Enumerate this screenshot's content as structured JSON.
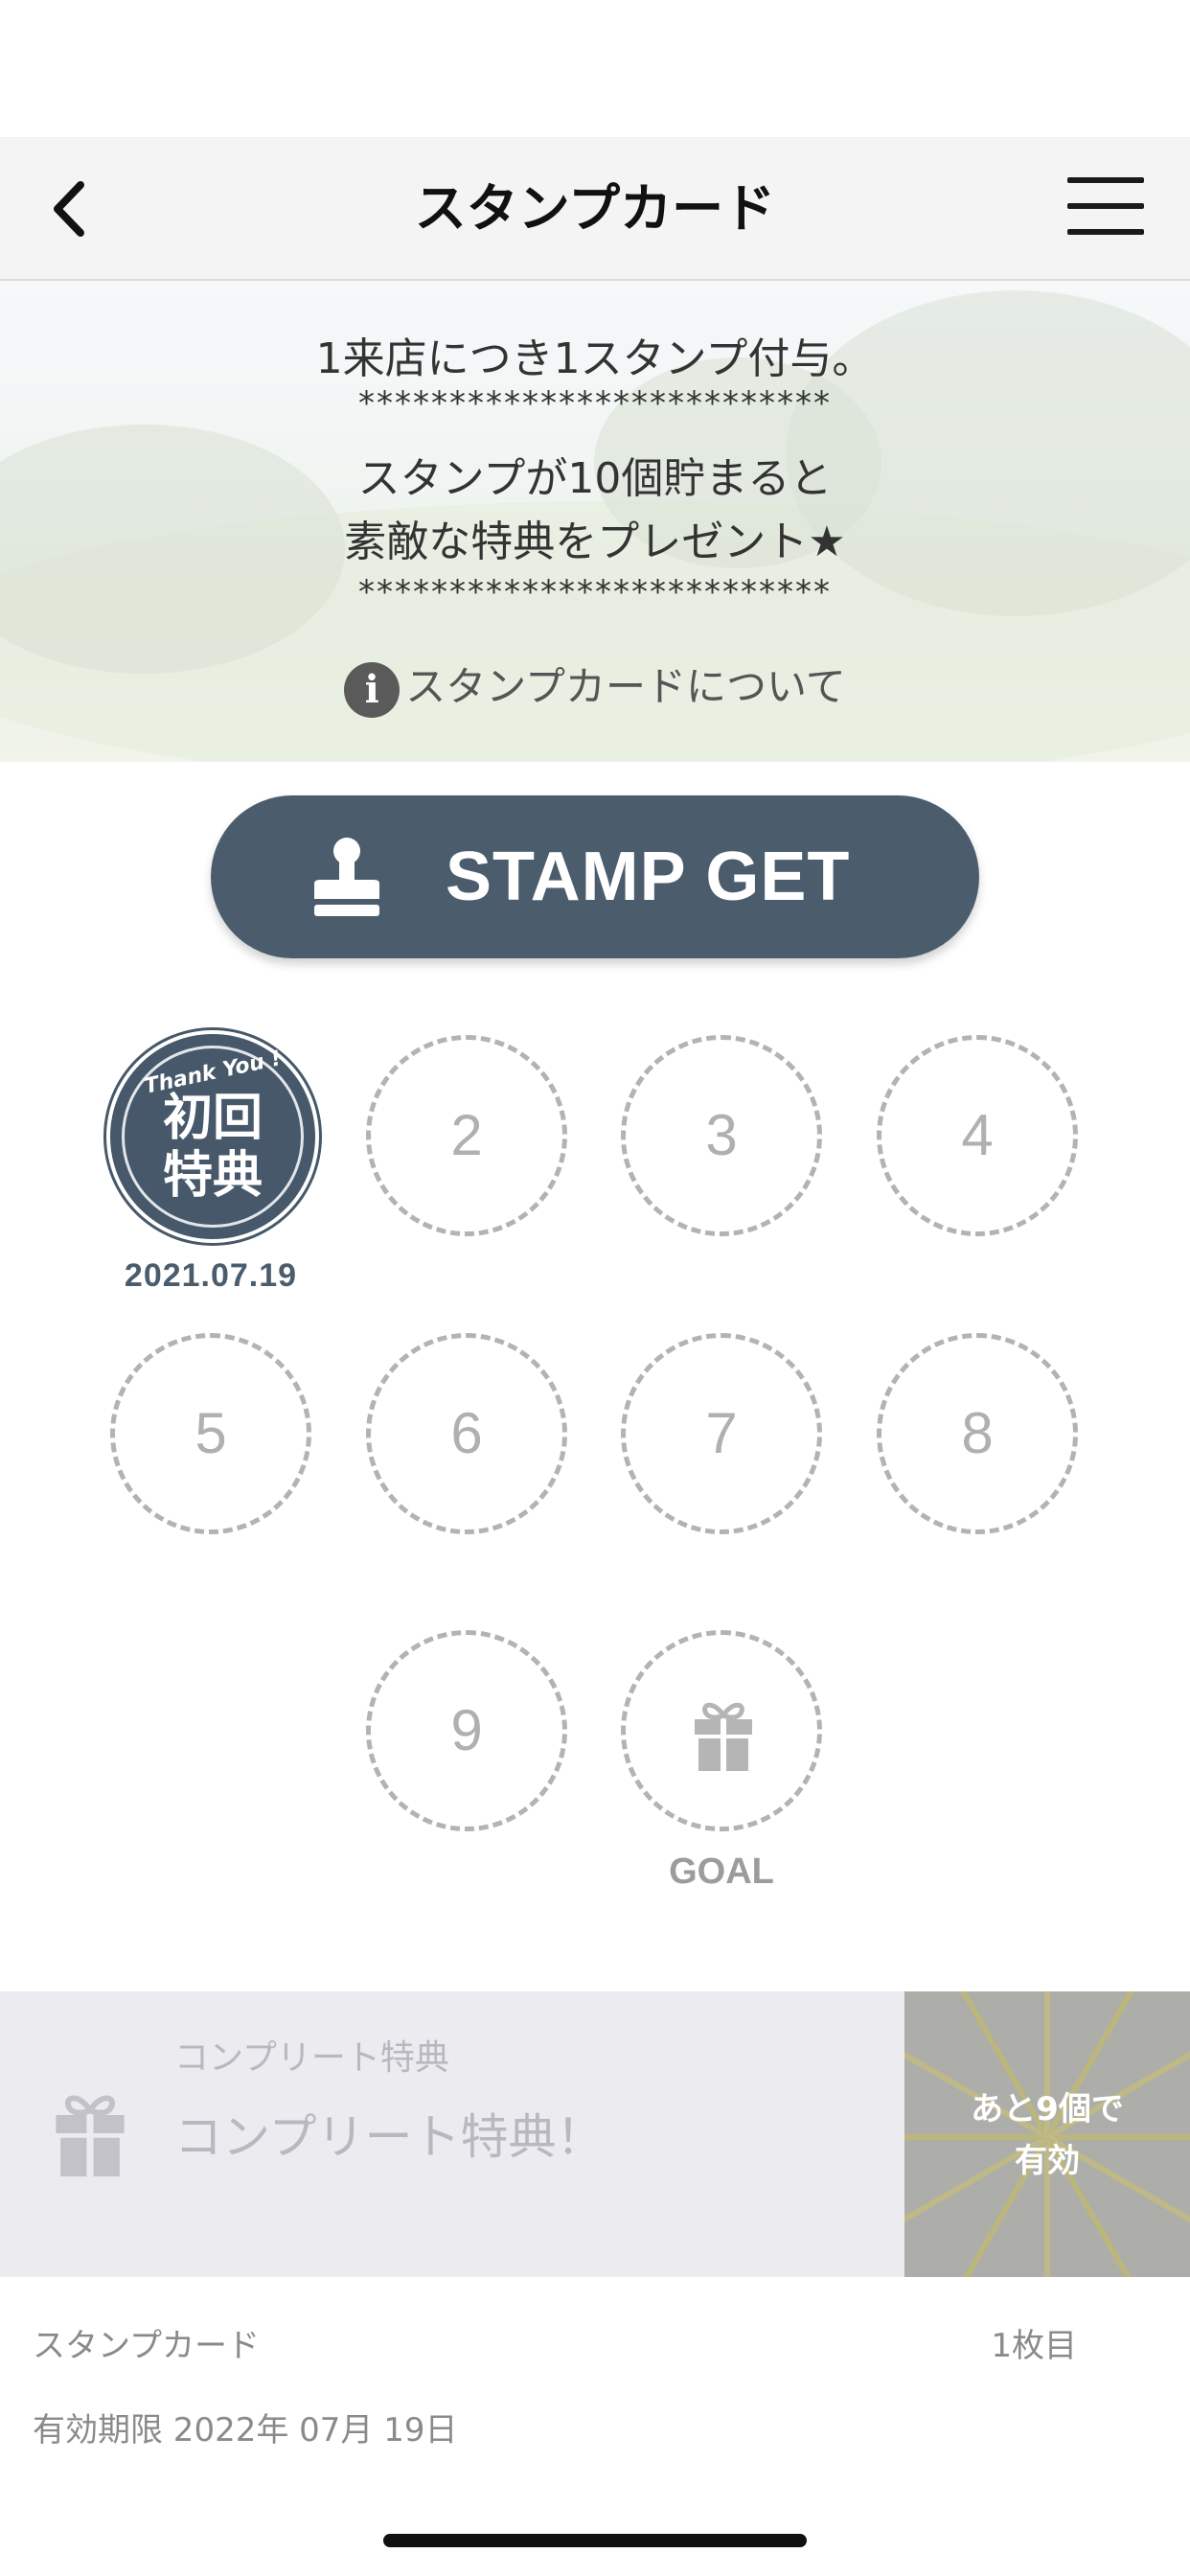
{
  "header": {
    "title": "スタンプカード",
    "back_icon": "chevron-left-icon",
    "menu_icon": "hamburger-menu-icon"
  },
  "banner": {
    "line1": "1来店につき1スタンプ付与。",
    "separator1": "**************************",
    "line2": "スタンプが10個貯まると",
    "line3": "素敵な特典をプレゼント★",
    "separator2": "**************************",
    "about_link": "スタンプカードについて",
    "info_icon": "info-icon",
    "info_glyph": "i"
  },
  "stamp_button": {
    "label": "STAMP GET",
    "icon": "stamp-icon"
  },
  "stamps": {
    "first": {
      "badge_text": "Thank You !",
      "line1": "初回",
      "line2": "特典",
      "date": "2021.07.19"
    },
    "slots": [
      "2",
      "3",
      "4",
      "5",
      "6",
      "7",
      "8",
      "9"
    ],
    "goal_label": "GOAL",
    "goal_icon": "gift-icon"
  },
  "reward": {
    "caption": "コンプリート特典",
    "title": "コンプリート特典！",
    "remaining_line1": "あと9個で",
    "remaining_line2": "有効",
    "icon": "gift-icon"
  },
  "footer": {
    "card_name": "スタンプカード",
    "card_count": "1枚目",
    "expiry": "有効期限 2022年 07月 19日"
  },
  "colors": {
    "accent": "#4b5d6d",
    "header_bg": "#f4f4f4",
    "reward_bg": "#ebebf0",
    "slot_border": "#b3b3b3"
  }
}
